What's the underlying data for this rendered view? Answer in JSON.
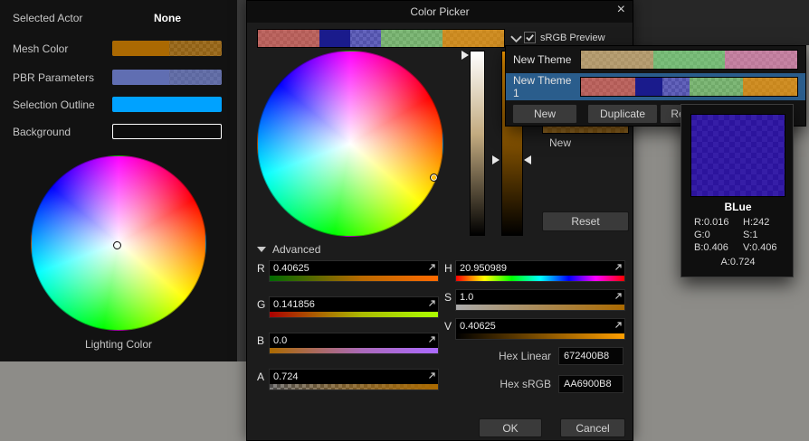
{
  "left_panel": {
    "header_label": "Selected Actor",
    "header_value": "None",
    "rows": [
      {
        "label": "Mesh Color"
      },
      {
        "label": "PBR Parameters"
      },
      {
        "label": "Selection Outline"
      },
      {
        "label": "Background"
      }
    ],
    "caption": "Lighting Color"
  },
  "dialog": {
    "title": "Color Picker",
    "close": "×",
    "srgb_label": "sRGB Preview",
    "new_label": "New",
    "reset_label": "Reset",
    "advanced_label": "Advanced",
    "channels": [
      {
        "label": "R",
        "value": "0.40625"
      },
      {
        "label": "G",
        "value": "0.141856"
      },
      {
        "label": "B",
        "value": "0.0"
      },
      {
        "label": "A",
        "value": "0.724"
      }
    ],
    "hsv": [
      {
        "label": "H",
        "value": "20.950989"
      },
      {
        "label": "S",
        "value": "1.0"
      },
      {
        "label": "V",
        "value": "0.40625"
      }
    ],
    "hex_linear_label": "Hex Linear",
    "hex_linear_value": "672400B8",
    "hex_srgb_label": "Hex sRGB",
    "hex_srgb_value": "AA6900B8",
    "ok_label": "OK",
    "cancel_label": "Cancel"
  },
  "theme_menu": {
    "items": [
      {
        "name": "New Theme"
      },
      {
        "name": "New Theme 1"
      }
    ],
    "buttons": [
      {
        "label": "New"
      },
      {
        "label": "Duplicate"
      },
      {
        "label": "Rename"
      }
    ]
  },
  "tooltip": {
    "title": "BLue",
    "left_col": [
      "R:0.016",
      "G:0",
      "B:0.406"
    ],
    "right_col": [
      "H:242",
      "S:1",
      "V:0.406"
    ],
    "alpha_line": "A:0.724"
  },
  "colors": {
    "accent_selected_row": "#2a5d8c",
    "mesh_opaque": "rgb(171,105,2)",
    "mesh_alpha": "rgba(171,105,2,0.72)",
    "pbr_opaque": "rgb(96,110,178)",
    "pbr_alpha": "rgba(96,110,178,0.82)",
    "selection_outline": "#00a2ff",
    "background_swatch": "#0d0d0d",
    "oldnew_color": "rgba(171,105,2,0.72)",
    "tooltip_swatch": "rgba(36,6,178,0.8)",
    "theme1_segments": [
      "rgba(206,96,90,0.78)",
      "rgb(26,27,140)",
      "rgba(84,84,219,0.65)",
      "rgba(128,206,118,0.72)",
      "rgba(222,146,22,0.85)"
    ],
    "theme0_segments": [
      "rgba(198,168,112,0.8)",
      "rgba(122,206,122,0.8)",
      "rgba(216,132,172,0.8)"
    ]
  }
}
